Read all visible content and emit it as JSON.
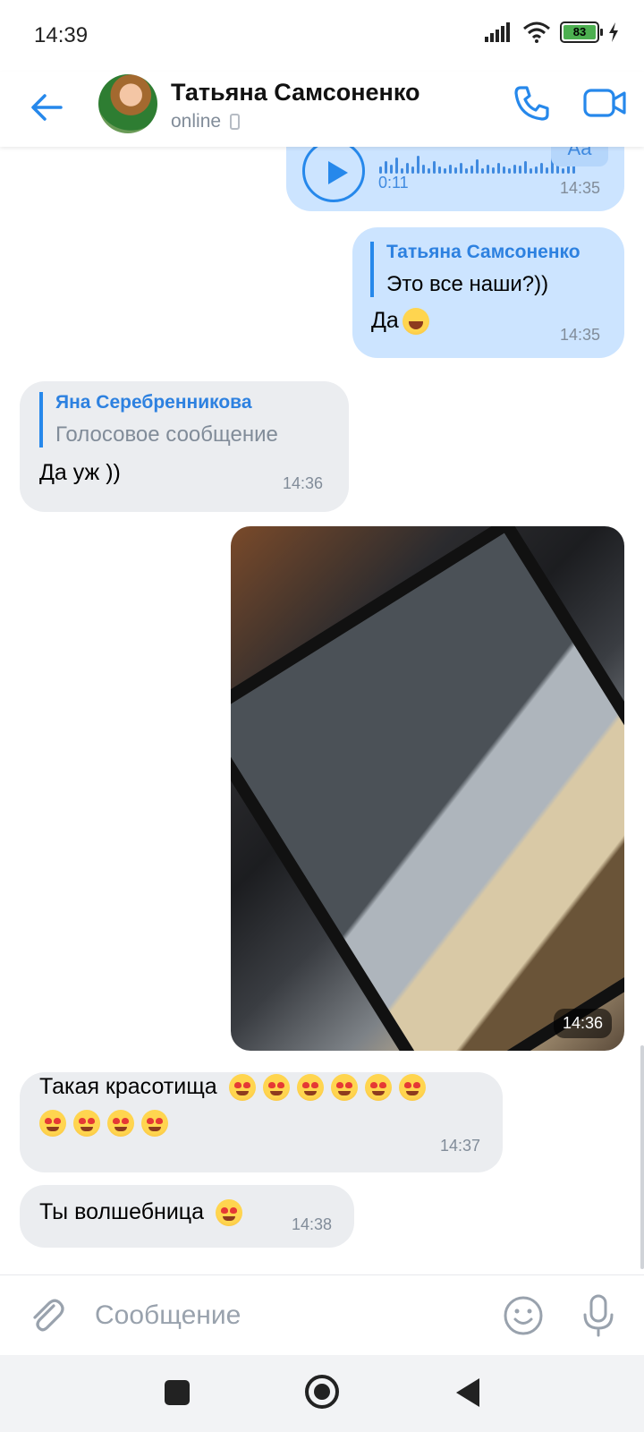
{
  "status_bar": {
    "time": "14:39",
    "battery": "83"
  },
  "header": {
    "contact_name": "Татьяна Самсоненко",
    "status": "online"
  },
  "messages": {
    "voice": {
      "duration": "0:11",
      "aa": "Aa",
      "time": "14:35"
    },
    "reply_out": {
      "quote_author": "Татьяна Самсоненко",
      "quote_text": "Это все наши?))",
      "text": "Да",
      "time": "14:35"
    },
    "reply_in": {
      "quote_author": "Яна Серебренникова",
      "quote_text": "Голосовое сообщение",
      "text": "Да уж ))",
      "time": "14:36"
    },
    "photo": {
      "time": "14:36"
    },
    "beauty": {
      "text": "Такая красотища",
      "time": "14:37"
    },
    "magic": {
      "text": "Ты волшебница",
      "time": "14:38"
    }
  },
  "composer": {
    "placeholder": "Сообщение"
  },
  "colors": {
    "accent": "#2688eb",
    "outgoing": "#cce4ff",
    "incoming": "#ebedf0"
  }
}
